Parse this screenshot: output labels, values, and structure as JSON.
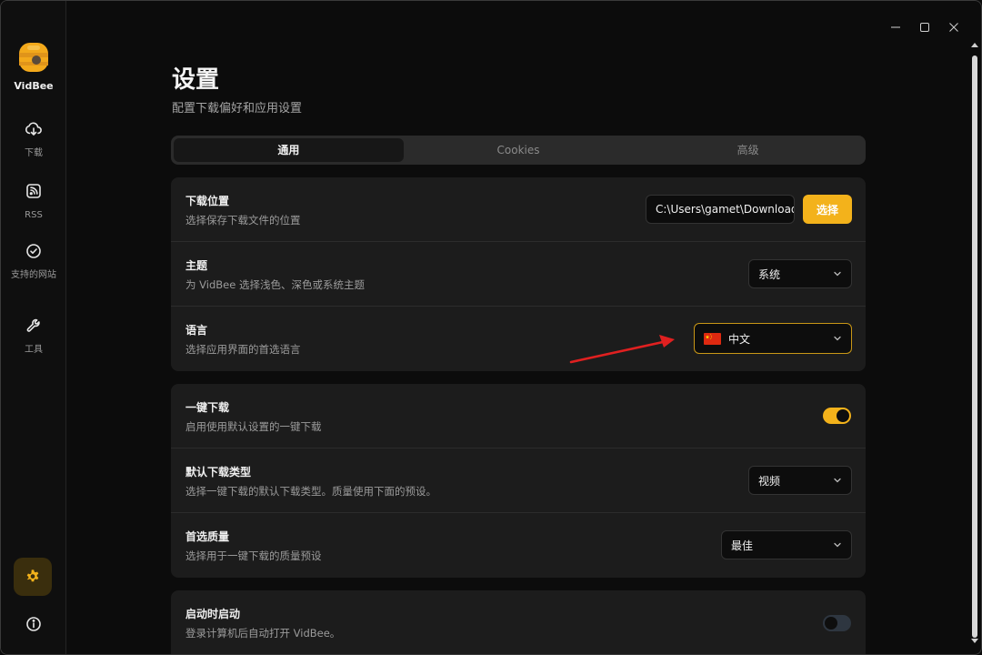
{
  "app": {
    "name": "VidBee"
  },
  "sidebar": {
    "items": [
      {
        "label": "下载",
        "icon": "download-cloud-icon"
      },
      {
        "label": "RSS",
        "icon": "rss-icon"
      },
      {
        "label": "支持的网站",
        "icon": "check-circle-icon"
      },
      {
        "label": "工具",
        "icon": "wrench-icon"
      }
    ],
    "settings_icon": "gear-icon",
    "info_icon": "info-icon"
  },
  "page": {
    "title": "设置",
    "subtitle": "配置下载偏好和应用设置"
  },
  "tabs": [
    {
      "label": "通用",
      "active": true
    },
    {
      "label": "Cookies",
      "active": false
    },
    {
      "label": "高级",
      "active": false
    }
  ],
  "settings": {
    "download_location": {
      "title": "下载位置",
      "desc": "选择保存下载文件的位置",
      "value": "C:\\Users\\gamet\\Downloads",
      "button": "选择"
    },
    "theme": {
      "title": "主题",
      "desc": "为 VidBee 选择浅色、深色或系统主题",
      "value": "系统"
    },
    "language": {
      "title": "语言",
      "desc": "选择应用界面的首选语言",
      "value": "中文"
    },
    "one_click": {
      "title": "一键下载",
      "desc": "启用使用默认设置的一键下载",
      "enabled": true
    },
    "default_type": {
      "title": "默认下载类型",
      "desc": "选择一键下载的默认下载类型。质量使用下面的预设。",
      "value": "视频"
    },
    "quality": {
      "title": "首选质量",
      "desc": "选择用于一键下载的质量预设",
      "value": "最佳"
    },
    "autostart": {
      "title": "启动时启动",
      "desc": "登录计算机后自动打开 VidBee。",
      "enabled": false
    }
  },
  "colors": {
    "accent": "#f3b21b",
    "background": "#0c0c0c",
    "card": "#1c1c1c",
    "annotation_arrow": "#e02020"
  }
}
